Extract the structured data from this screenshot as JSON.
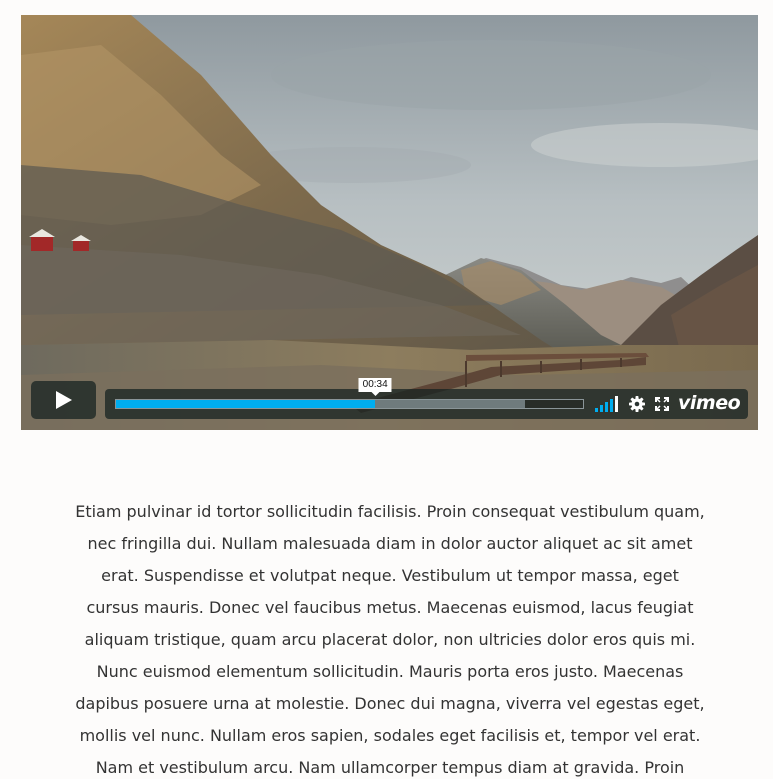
{
  "video_player": {
    "timecode": "00:34",
    "progress_played": 0.555,
    "progress_loaded": 0.875,
    "volume_bars": 5,
    "volume_level": 0.7,
    "brand": "vimeo",
    "accent_color": "#00adef",
    "icons": {
      "play": "play-icon",
      "volume": "volume-icon",
      "settings": "gear-icon",
      "fullscreen": "fullscreen-icon",
      "brand": "vimeo-logo"
    }
  },
  "article": {
    "paragraph": "Etiam pulvinar id tortor sollicitudin facilisis. Proin consequat vestibulum quam, nec fringilla dui. Nullam malesuada diam in dolor auctor aliquet ac sit amet erat. Suspendisse et volutpat neque. Vestibulum ut tempor massa, eget cursus mauris. Donec vel faucibus metus. Maecenas euismod, lacus feugiat aliquam tristique, quam arcu placerat dolor, non ultricies dolor eros quis mi. Nunc euismod elementum sollicitudin. Mauris porta eros justo. Maecenas dapibus posuere urna at molestie. Donec dui magna, viverra vel egestas eget, mollis vel nunc. Nullam eros sapien, sodales eget facilisis et, tempor vel erat. Nam et vestibulum arcu. Nam ullamcorper tempus diam at gravida. Proin auctor libero"
  }
}
